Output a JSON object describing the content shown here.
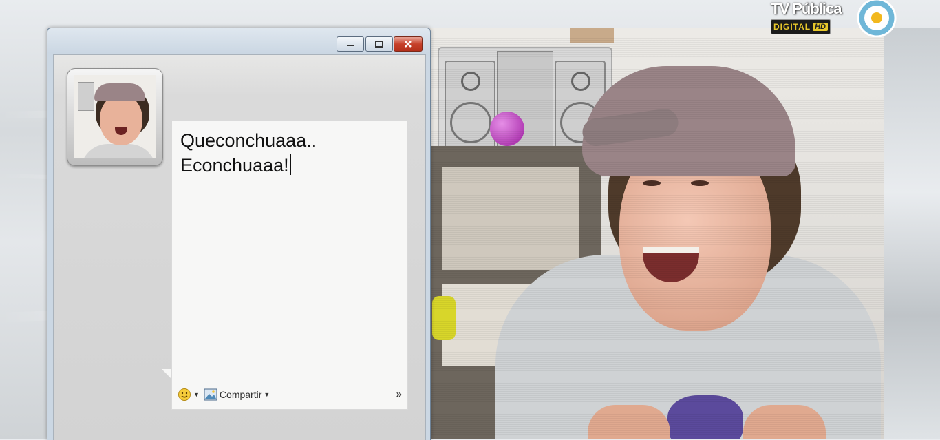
{
  "broadcast": {
    "name": "TV Pública",
    "badge_text": "DIGITAL",
    "badge_hd": "HD"
  },
  "chat_window": {
    "message": "Queconchuaaa..\nEconchuaaa!",
    "toolbar": {
      "emoticon_icon": "smiley-icon",
      "share_icon": "image-icon",
      "share_label": "Compartir",
      "more_label": "»"
    }
  },
  "colors": {
    "close_button": "#c6412b",
    "tv_badge": "#e8c82a"
  }
}
